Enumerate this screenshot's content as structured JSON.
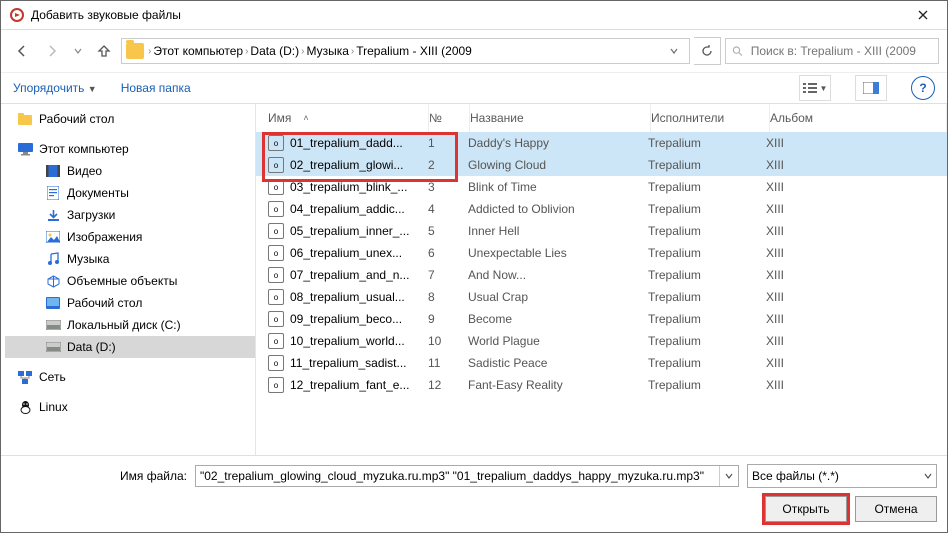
{
  "title": "Добавить звуковые файлы",
  "breadcrumbs": [
    "Этот компьютер",
    "Data (D:)",
    "Музыка",
    "Trepalium - XIII (2009"
  ],
  "search": {
    "placeholder": "Поиск в: Trepalium - XIII (2009"
  },
  "toolbar": {
    "organize": "Упорядочить",
    "newfolder": "Новая папка"
  },
  "sidebar": {
    "desktop_top": "Рабочий стол",
    "this_pc": "Этот компьютер",
    "items": [
      {
        "label": "Видео"
      },
      {
        "label": "Документы"
      },
      {
        "label": "Загрузки"
      },
      {
        "label": "Изображения"
      },
      {
        "label": "Музыка"
      },
      {
        "label": "Объемные объекты"
      },
      {
        "label": "Рабочий стол"
      },
      {
        "label": "Локальный диск (С:)"
      },
      {
        "label": "Data (D:)"
      }
    ],
    "network": "Сеть",
    "linux": "Linux"
  },
  "columns": {
    "name": "Имя",
    "no": "№",
    "title": "Название",
    "artist": "Исполнители",
    "album": "Альбом"
  },
  "files": [
    {
      "name": "01_trepalium_dadd...",
      "no": "1",
      "title": "Daddy's Happy",
      "artist": "Trepalium",
      "album": "XIII",
      "selected": true
    },
    {
      "name": "02_trepalium_glowi...",
      "no": "2",
      "title": "Glowing Cloud",
      "artist": "Trepalium",
      "album": "XIII",
      "selected": true
    },
    {
      "name": "03_trepalium_blink_...",
      "no": "3",
      "title": "Blink of Time",
      "artist": "Trepalium",
      "album": "XIII"
    },
    {
      "name": "04_trepalium_addic...",
      "no": "4",
      "title": "Addicted to Oblivion",
      "artist": "Trepalium",
      "album": "XIII"
    },
    {
      "name": "05_trepalium_inner_...",
      "no": "5",
      "title": "Inner Hell",
      "artist": "Trepalium",
      "album": "XIII"
    },
    {
      "name": "06_trepalium_unex...",
      "no": "6",
      "title": "Unexpectable Lies",
      "artist": "Trepalium",
      "album": "XIII"
    },
    {
      "name": "07_trepalium_and_n...",
      "no": "7",
      "title": "And Now...",
      "artist": "Trepalium",
      "album": "XIII"
    },
    {
      "name": "08_trepalium_usual...",
      "no": "8",
      "title": "Usual Crap",
      "artist": "Trepalium",
      "album": "XIII"
    },
    {
      "name": "09_trepalium_beco...",
      "no": "9",
      "title": "Become",
      "artist": "Trepalium",
      "album": "XIII"
    },
    {
      "name": "10_trepalium_world...",
      "no": "10",
      "title": "World Plague",
      "artist": "Trepalium",
      "album": "XIII"
    },
    {
      "name": "11_trepalium_sadist...",
      "no": "11",
      "title": "Sadistic Peace",
      "artist": "Trepalium",
      "album": "XIII"
    },
    {
      "name": "12_trepalium_fant_e...",
      "no": "12",
      "title": "Fant-Easy Reality",
      "artist": "Trepalium",
      "album": "XIII"
    }
  ],
  "footer": {
    "filename_label": "Имя файла:",
    "filename_value": "\"02_trepalium_glowing_cloud_myzuka.ru.mp3\" \"01_trepalium_daddys_happy_myzuka.ru.mp3\"",
    "filter": "Все файлы (*.*)",
    "open": "Открыть",
    "cancel": "Отмена"
  }
}
